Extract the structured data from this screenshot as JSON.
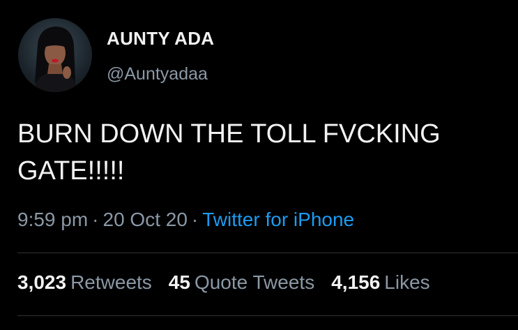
{
  "author": {
    "display_name": "AUNTY ADA",
    "handle": "@Auntyadaa"
  },
  "tweet": {
    "lines": [
      "BURN DOWN THE TOLL FVCKING",
      "GATE!!!!!"
    ],
    "time": "9:59 pm",
    "date": "20 Oct 20",
    "separator": "·",
    "source": "Twitter for iPhone"
  },
  "stats": {
    "retweets": {
      "count": "3,023",
      "label": "Retweets"
    },
    "quotes": {
      "count": "45",
      "label": "Quote Tweets"
    },
    "likes": {
      "count": "4,156",
      "label": "Likes"
    }
  },
  "colors": {
    "background": "#000000",
    "text": "#f2f2f2",
    "muted": "#8b98a5",
    "link": "#1d9bf0"
  }
}
